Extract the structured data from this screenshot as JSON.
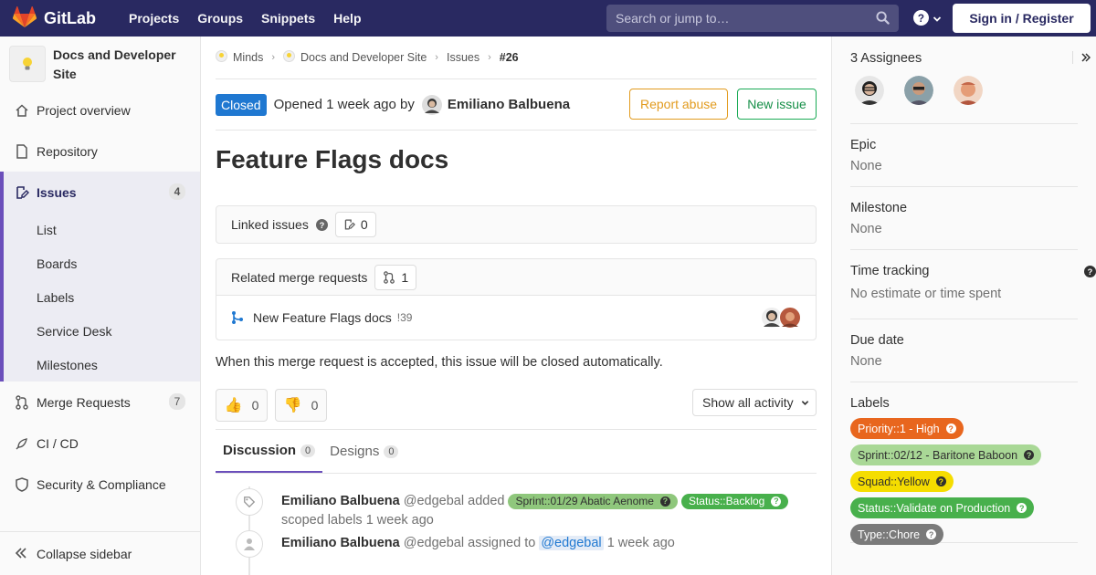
{
  "topbar": {
    "brand": "GitLab",
    "nav": [
      "Projects",
      "Groups",
      "Snippets",
      "Help"
    ],
    "search_placeholder": "Search or jump to…",
    "signin": "Sign in / Register"
  },
  "sidebar": {
    "project_name": "Docs and Developer Site",
    "items": [
      {
        "label": "Project overview",
        "icon": "home-icon"
      },
      {
        "label": "Repository",
        "icon": "doc-icon"
      },
      {
        "label": "Issues",
        "icon": "issues-icon",
        "count": "4"
      },
      {
        "label": "Merge Requests",
        "icon": "merge-request-icon",
        "count": "7"
      },
      {
        "label": "CI / CD",
        "icon": "rocket-icon"
      },
      {
        "label": "Security & Compliance",
        "icon": "shield-icon"
      }
    ],
    "issues_sub": [
      "List",
      "Boards",
      "Labels",
      "Service Desk",
      "Milestones"
    ],
    "collapse": "Collapse sidebar"
  },
  "breadcrumb": {
    "items": [
      "Minds",
      "Docs and Developer Site",
      "Issues"
    ],
    "current": "#26"
  },
  "issue": {
    "status": "Closed",
    "opened_text": "Opened 1 week ago by",
    "author": "Emiliano Balbuena",
    "report_abuse": "Report abuse",
    "new_issue": "New issue",
    "title": "Feature Flags docs"
  },
  "linked": {
    "label": "Linked issues",
    "count": "0"
  },
  "related": {
    "label": "Related merge requests",
    "count": "1",
    "mr_title": "New Feature Flags docs",
    "mr_ref": "!39",
    "note": "When this merge request is accepted, this issue will be closed automatically."
  },
  "awards": {
    "thumbsup": "0",
    "thumbsdown": "0",
    "activity": "Show all activity"
  },
  "tabs": [
    {
      "label": "Discussion",
      "count": "0"
    },
    {
      "label": "Designs",
      "count": "0"
    }
  ],
  "events": [
    {
      "author": "Emiliano Balbuena",
      "handle": "@edgebal",
      "action": "added",
      "labels": [
        {
          "text": "Sprint::01/29 Abatic Aenome",
          "color": "#8fc77c"
        },
        {
          "text": "Status::Backlog",
          "color": "#48b04c"
        }
      ],
      "tail": "scoped labels 1 week ago"
    },
    {
      "author": "Emiliano Balbuena",
      "handle": "@edgebal",
      "action": "assigned to",
      "mention": "@edgebal",
      "time": "1 week ago"
    }
  ],
  "right": {
    "assignees_title": "3 Assignees",
    "epic_title": "Epic",
    "epic_value": "None",
    "milestone_title": "Milestone",
    "milestone_value": "None",
    "time_title": "Time tracking",
    "time_value": "No estimate or time spent",
    "due_title": "Due date",
    "due_value": "None",
    "labels_title": "Labels",
    "labels": [
      {
        "text": "Priority::1 - High",
        "bg": "#e8661e",
        "fg": "#ffffff"
      },
      {
        "text": "Sprint::02/12 - Baritone Baboon",
        "bg": "#a9d896",
        "fg": "#303030"
      },
      {
        "text": "Squad::Yellow",
        "bg": "#f5dd00",
        "fg": "#303030"
      },
      {
        "text": "Status::Validate on Production",
        "bg": "#48b04c",
        "fg": "#ffffff"
      },
      {
        "text": "Type::Chore",
        "bg": "#7a7a7a",
        "fg": "#ffffff"
      }
    ]
  },
  "colors": {
    "navbar": "#292961",
    "closed_badge": "#1f78d1",
    "active_accent": "#6b4fbb"
  }
}
